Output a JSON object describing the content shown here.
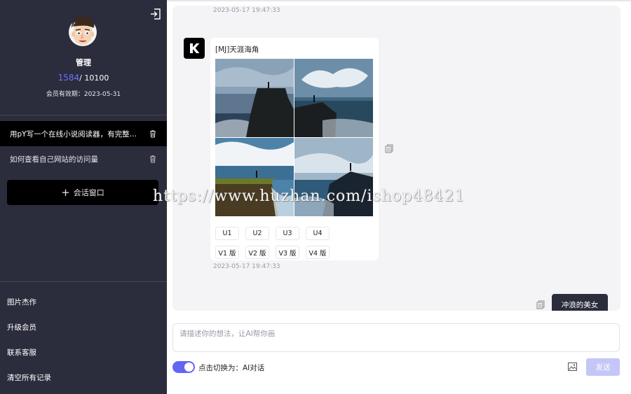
{
  "sidebar": {
    "user_name": "管理",
    "quota_used": "1584",
    "quota_total": "/ 10100",
    "expire": "会员有效期：2023-05-31",
    "conversations": [
      {
        "title": "用pY写一个在线小说阅读器，有完整的代码",
        "active": true
      },
      {
        "title": "如何查看自己网站的访问量",
        "active": false
      }
    ],
    "new_chat_label": "会话窗口",
    "menu": [
      "图片杰作",
      "升级会员",
      "联系客服",
      "清空所有记录"
    ]
  },
  "chat": {
    "timestamp_top": "2023-05-17 19:47:33",
    "bot_message": {
      "caption": "[MJ]天涯海角",
      "upscale_buttons": [
        "U1",
        "U2",
        "U3",
        "U4"
      ],
      "variation_buttons": [
        "V1 版",
        "V2 版",
        "V3 版",
        "V4 版"
      ],
      "timestamp": "2023-05-17 19:47:33"
    },
    "user_message": "冲浪的美女"
  },
  "composer": {
    "placeholder": "请描述你的想法，让AI帮你画",
    "toggle_label": "点击切换为：AI对话",
    "send_label": "发送"
  },
  "watermark": "https://www.huzhan.com/ishop48421",
  "colors": {
    "sidebar_bg": "#2b2c3c",
    "accent": "#6366f1",
    "quota_used": "#6b72ff",
    "send_disabled": "#c4c6f7"
  }
}
